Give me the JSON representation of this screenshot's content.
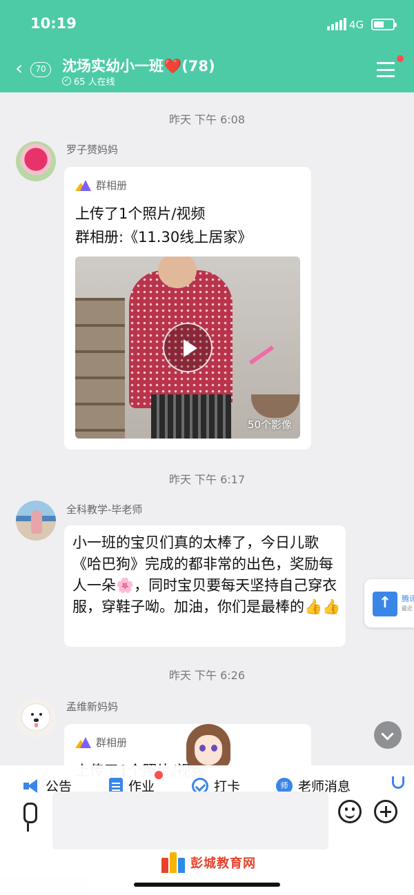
{
  "status_bar": {
    "time": "10:19",
    "network": "4G"
  },
  "header": {
    "back_count": "70",
    "group_name": "沈场实幼小一班",
    "heart": "❤️",
    "member_count": "(78)",
    "online": "65 人在线"
  },
  "messages": [
    {
      "time": "昨天  下午 6:08",
      "sender": "罗子赟妈妈",
      "album_label": "群相册",
      "line1": "上传了1个照片/视频",
      "line2": "群相册:《11.30线上居家》",
      "media_count": "50个影像"
    },
    {
      "time": "昨天  下午 6:17",
      "sender": "全科教学-毕老师",
      "text": "小一班的宝贝们真的太棒了，今日儿歌《哈巴狗》完成的都非常的出色，奖励每人一朵🌸，同时宝贝要每天坚持自己穿衣服，穿鞋子呦。加油，你们是最棒的👍👍"
    },
    {
      "time": "昨天  下午 6:26",
      "sender": "孟维新妈妈",
      "album_label": "群相册",
      "line1": "上传了1个照片/视频"
    }
  ],
  "side_card": {
    "title": "腾讯",
    "subtitle": "最近"
  },
  "toolbar": {
    "items": [
      {
        "label": "公告",
        "icon": "megaphone-icon"
      },
      {
        "label": "作业",
        "icon": "document-icon"
      },
      {
        "label": "打卡",
        "icon": "check-circle-icon"
      },
      {
        "label": "老师消息",
        "icon": "teacher-icon"
      },
      {
        "label": "",
        "icon": "more-icon"
      }
    ]
  },
  "watermark": "彭城教育网",
  "colors": {
    "header": "#4dcba7",
    "accent": "#3a86e8",
    "badge": "#ff4d4f"
  }
}
